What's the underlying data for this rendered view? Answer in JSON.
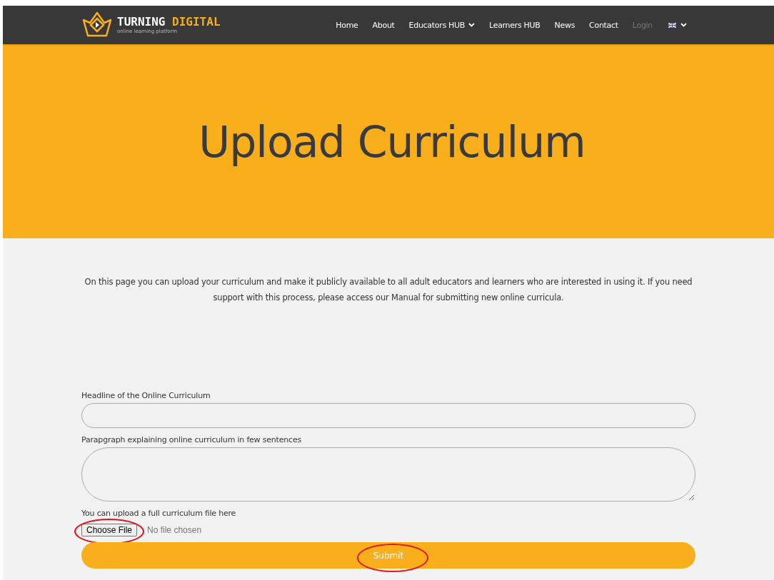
{
  "brand": {
    "name_part1": "TURNING",
    "name_part2": "DIGITAL",
    "tagline": "online learning platform"
  },
  "nav": [
    {
      "label": "Home",
      "dropdown": false,
      "disabled": false
    },
    {
      "label": "About",
      "dropdown": false,
      "disabled": false
    },
    {
      "label": "Educators HUB",
      "dropdown": true,
      "disabled": false
    },
    {
      "label": "Learners HUB",
      "dropdown": false,
      "disabled": false
    },
    {
      "label": "News",
      "dropdown": false,
      "disabled": false
    },
    {
      "label": "Contact",
      "dropdown": false,
      "disabled": false
    },
    {
      "label": "Login",
      "dropdown": false,
      "disabled": true
    }
  ],
  "hero": {
    "title": "Upload Curriculum"
  },
  "intro": "On this page you can upload your curriculum and make it publicly available to all adult educators and learners who are interested in using it. If you need support with this process, please access our Manual for submitting new online curricula.",
  "form": {
    "fields": [
      {
        "kind": "input",
        "label": "Headline of the Online Curriculum"
      },
      {
        "kind": "textarea",
        "label": "Parapgraph explaining online curriculum in few sentences"
      },
      {
        "kind": "file",
        "label": "You can upload a full curriculum file here",
        "button": "Choose File",
        "status": "No file chosen"
      }
    ],
    "submit": "Submit"
  }
}
